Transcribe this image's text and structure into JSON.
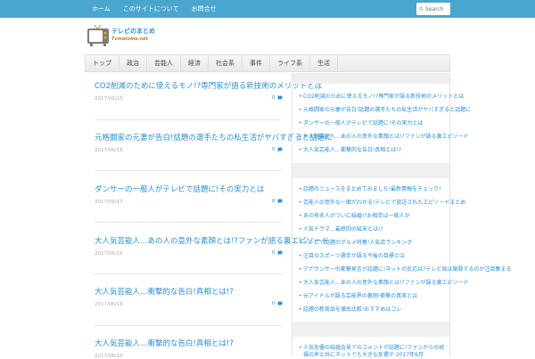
{
  "topnav": {
    "items": [
      "ホーム",
      "このサイトについて",
      "お問合せ"
    ],
    "search_placeholder": "Search"
  },
  "logo": {
    "text1": "テレビのまとめ",
    "text2": "Tvmatome.net"
  },
  "mainnav": {
    "items": [
      "トップ",
      "政治",
      "芸能人",
      "経済",
      "社会系",
      "事件",
      "ライフ系",
      "生活"
    ]
  },
  "posts": [
    {
      "title": "CO2削減のために使えるモノ!?専門家が語る新技術のメリットとは",
      "date": "2017/06/25",
      "comments": "0"
    },
    {
      "title": "元格闘家の元妻が告白!話題の選手たちの私生活がヤバすぎると話題に",
      "date": "2017/06/18",
      "comments": "0"
    },
    {
      "title": "ダンサーの一般人がテレビで話題に!その実力とは",
      "date": "2017/06/17",
      "comments": "0"
    },
    {
      "title": "大人気芸能人…あの人の意外な素顔とは!?ファンが語る裏エピソード",
      "date": "2017/06/16",
      "comments": "0"
    },
    {
      "title": "大人気芸能人…衝撃的な告白!真相とは!?",
      "date": "2017/06/16",
      "comments": "0"
    },
    {
      "title": "大人気芸能人…衝撃的な告白!真相とは!?",
      "date": "2017/06/16",
      "comments": "0"
    }
  ],
  "sidebar": {
    "group1": [
      "CO2削減のために使えるモノ!?専門家が語る新技術のメリットとは",
      "元格闘家の元妻が告白!話題の選手たちの私生活がヤバすぎると話題に",
      "ダンサーの一般人がテレビで話題に!その実力とは",
      "大人気芸能人…あの人の意外な素顔とは!?ファンが語る裏エピソード",
      "大人気芸能人…衝撃的な告白!真相とは!?"
    ],
    "group2": [
      "話題のニュースをまとめてみました!最新情報をチェック!",
      "芸能人の意外な一面がわかる!テレビで放送されたエピソードまとめ",
      "あの有名人がついに結婚!?お相手は一般人か",
      "人気ドラマ…最終回の結末とは!?",
      "テレビで話題のグルメ特集!人気店ランキング",
      "注目のスポーツ選手が語る今後の目標とは",
      "アナウンサーの衝撃発言が話題に!ネットの反応は?テレビ局は謝罪するのか注目集まる",
      "大人気芸能人…あの人の意外な素顔とは!?ファンが語る裏エピソード",
      "元アイドルが語る芸能界の裏側!衝撃の真実とは",
      "話題の新商品を徹底比較!おすすめはコレ"
    ],
    "group3": [
      "人気女優の結婚会見でのコメントが話題に!ファンからの祝福の声と共にネットでも大きな反響が 2017年6月"
    ]
  }
}
